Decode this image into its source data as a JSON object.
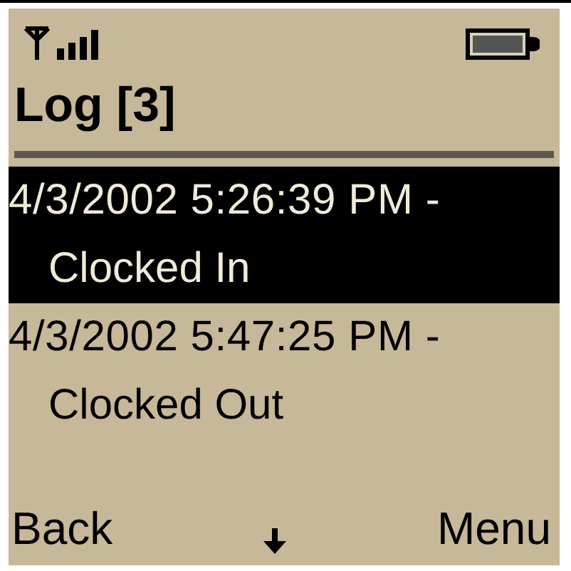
{
  "title": "Log [3]",
  "entries": [
    {
      "timestamp": "4/3/2002 5:26:39 PM -",
      "event": "Clocked In",
      "selected": true
    },
    {
      "timestamp": "4/3/2002 5:47:25 PM -",
      "event": "Clocked Out",
      "selected": false
    }
  ],
  "softkeys": {
    "left": "Back",
    "right": "Menu"
  }
}
